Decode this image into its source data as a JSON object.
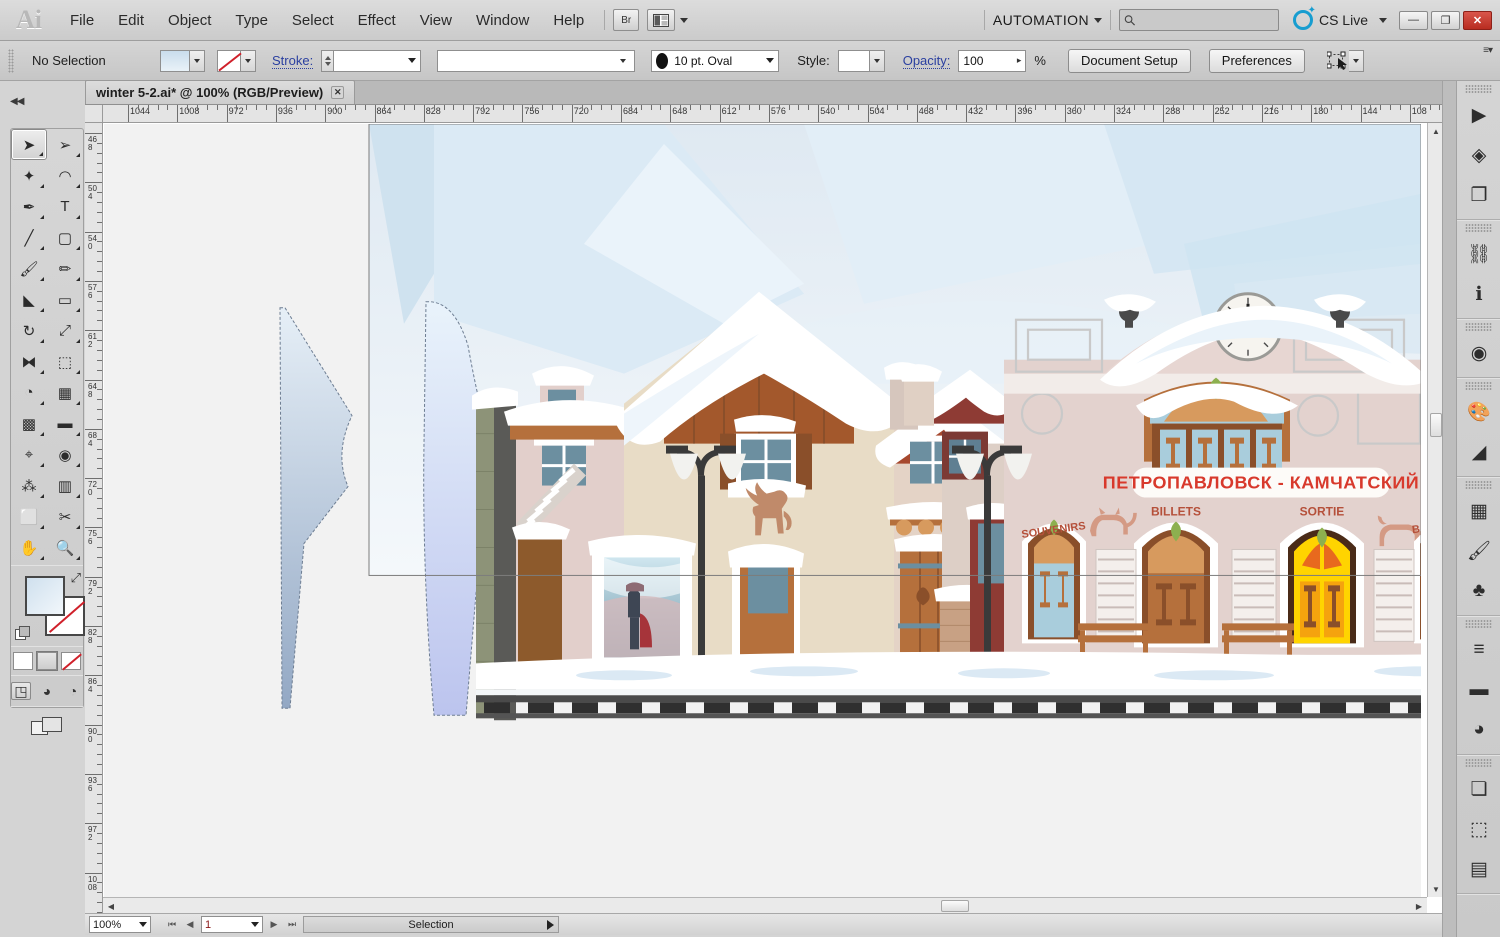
{
  "app": {
    "name": "Adobe Illustrator",
    "logo": "Ai",
    "bridge_label": "Br"
  },
  "menubar": {
    "items": [
      "File",
      "Edit",
      "Object",
      "Type",
      "Select",
      "Effect",
      "View",
      "Window",
      "Help"
    ],
    "workspace": "AUTOMATION",
    "search_placeholder": "",
    "cs_live": "CS Live",
    "window_buttons": {
      "minimize": "—",
      "restore": "❐",
      "close": "✕"
    }
  },
  "controlbar": {
    "selection_label": "No Selection",
    "stroke_label": "Stroke:",
    "stroke_weight": "",
    "stroke_profile": "",
    "brush_label": "10 pt. Oval",
    "style_label": "Style:",
    "opacity_label": "Opacity:",
    "opacity_value": "100",
    "percent": "%",
    "document_setup": "Document Setup",
    "preferences": "Preferences"
  },
  "tabs": {
    "documents": [
      {
        "title": "winter 5-2.ai* @ 100% (RGB/Preview)",
        "close": "✕",
        "active": true
      }
    ]
  },
  "rulers": {
    "horizontal": [
      "1044",
      "1008",
      "972",
      "936",
      "900",
      "864",
      "828",
      "792",
      "756",
      "720",
      "684",
      "648",
      "612",
      "576",
      "540",
      "504",
      "468",
      "432",
      "396",
      "360",
      "324",
      "288",
      "252",
      "216",
      "180",
      "144",
      "108"
    ],
    "vertical": [
      "468",
      "504",
      "540",
      "576",
      "612",
      "648",
      "684",
      "720",
      "756",
      "792",
      "828",
      "864",
      "900",
      "936",
      "972",
      "1008"
    ],
    "units": "pt"
  },
  "toolbar": {
    "tools": [
      {
        "name": "selection-tool",
        "glyph": "➤",
        "selected": true
      },
      {
        "name": "direct-selection-tool",
        "glyph": "➢",
        "selected": false
      },
      {
        "name": "magic-wand-tool",
        "glyph": "✦",
        "selected": false
      },
      {
        "name": "lasso-tool",
        "glyph": "◠",
        "selected": false
      },
      {
        "name": "pen-tool",
        "glyph": "✒",
        "selected": false
      },
      {
        "name": "type-tool",
        "glyph": "T",
        "selected": false
      },
      {
        "name": "line-segment-tool",
        "glyph": "╱",
        "selected": false
      },
      {
        "name": "rectangle-tool",
        "glyph": "▢",
        "selected": false
      },
      {
        "name": "paintbrush-tool",
        "glyph": "🖌",
        "selected": false
      },
      {
        "name": "pencil-tool",
        "glyph": "✏",
        "selected": false
      },
      {
        "name": "blob-brush-tool",
        "glyph": "◣",
        "selected": false
      },
      {
        "name": "eraser-tool",
        "glyph": "▭",
        "selected": false
      },
      {
        "name": "rotate-tool",
        "glyph": "↻",
        "selected": false
      },
      {
        "name": "scale-tool",
        "glyph": "⤢",
        "selected": false
      },
      {
        "name": "width-tool",
        "glyph": "⧓",
        "selected": false
      },
      {
        "name": "free-transform-tool",
        "glyph": "⬚",
        "selected": false
      },
      {
        "name": "shape-builder-tool",
        "glyph": "◔",
        "selected": false
      },
      {
        "name": "perspective-grid-tool",
        "glyph": "▦",
        "selected": false
      },
      {
        "name": "mesh-tool",
        "glyph": "▩",
        "selected": false
      },
      {
        "name": "gradient-tool",
        "glyph": "▬",
        "selected": false
      },
      {
        "name": "eyedropper-tool",
        "glyph": "⌖",
        "selected": false
      },
      {
        "name": "blend-tool",
        "glyph": "◉",
        "selected": false
      },
      {
        "name": "symbol-sprayer-tool",
        "glyph": "⁂",
        "selected": false
      },
      {
        "name": "column-graph-tool",
        "glyph": "▥",
        "selected": false
      },
      {
        "name": "artboard-tool",
        "glyph": "⬜",
        "selected": false
      },
      {
        "name": "slice-tool",
        "glyph": "✂",
        "selected": false
      },
      {
        "name": "hand-tool",
        "glyph": "✋",
        "selected": false
      },
      {
        "name": "zoom-tool",
        "glyph": "🔍",
        "selected": false
      }
    ],
    "fill_stroke": {
      "swap": "⤢",
      "default": ""
    },
    "paint_modes": [
      "color-mode",
      "gradient-mode",
      "none-mode"
    ],
    "draw_modes": [
      "draw-normal",
      "draw-behind",
      "draw-inside"
    ],
    "screen_mode": "change-screen-mode"
  },
  "rightdock": {
    "groups": [
      {
        "icons": [
          {
            "name": "actions-panel-icon",
            "glyph": "▶"
          },
          {
            "name": "layers-panel-icon",
            "glyph": "◈"
          },
          {
            "name": "artboards-panel-icon",
            "glyph": "❐"
          }
        ]
      },
      {
        "icons": [
          {
            "name": "links-panel-icon",
            "glyph": "⛓"
          },
          {
            "name": "document-info-panel-icon",
            "glyph": "ℹ"
          }
        ]
      },
      {
        "icons": [
          {
            "name": "appearance-panel-icon",
            "glyph": "◉"
          }
        ]
      },
      {
        "icons": [
          {
            "name": "color-panel-icon",
            "glyph": "🎨"
          },
          {
            "name": "color-guide-panel-icon",
            "glyph": "◢"
          }
        ]
      },
      {
        "icons": [
          {
            "name": "swatches-panel-icon",
            "glyph": "▦"
          },
          {
            "name": "brushes-panel-icon",
            "glyph": "🖌"
          },
          {
            "name": "symbols-panel-icon",
            "glyph": "♣"
          }
        ]
      },
      {
        "icons": [
          {
            "name": "stroke-panel-icon",
            "glyph": "≡"
          },
          {
            "name": "gradient-panel-icon",
            "glyph": "▬"
          },
          {
            "name": "transparency-panel-icon",
            "glyph": "◕"
          }
        ]
      },
      {
        "icons": [
          {
            "name": "align-panel-icon",
            "glyph": "❏"
          },
          {
            "name": "transform-panel-icon",
            "glyph": "⬚"
          },
          {
            "name": "pathfinder-panel-icon",
            "glyph": "▤"
          }
        ]
      }
    ]
  },
  "statusbar": {
    "zoom": "100%",
    "page": "1",
    "status_text": "Selection",
    "first_label": "⏮",
    "prev_label": "◀",
    "next_label": "▶",
    "last_label": "⏭"
  },
  "artwork": {
    "title": "Snowy mountain railway station illustration",
    "station_sign": "ПЕТРОПАВЛОВСК - КАМЧАТСКИЙ",
    "arch_labels": [
      "SOUVENIRS",
      "BILLETS",
      "SORTIE",
      "BAGAGES"
    ],
    "clock_time": "12:20",
    "palette": {
      "sky": "#e8f0f6",
      "mountain_far": "#d8e7f2",
      "mountain_near": "#b9d5e8",
      "snow": "#ffffff",
      "snow_shadow": "#dbe9f4",
      "station_wall": "#e8d6d2",
      "chalet_wall": "#e8dcc6",
      "wood_dark": "#8a4f2a",
      "wood_mid": "#b5703c",
      "wood_light": "#d79a5e",
      "sign_red": "#d8392c",
      "lamp_black": "#3a3a3a",
      "rail_dark": "#3c3c3c",
      "glass_blue": "#a9cddc",
      "green_accent": "#8db04f",
      "yellow_accent": "#ffd400",
      "orange_accent": "#e8691e",
      "ice_blue": "#c6dced",
      "stone_green": "#8d9378"
    }
  }
}
